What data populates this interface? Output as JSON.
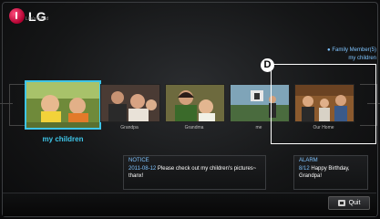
{
  "logo": {
    "brand": "LG",
    "tagline": "Life's Good"
  },
  "header": {
    "member_label": "Family Member(5)",
    "group_label": "my children"
  },
  "callout": {
    "marker": "D"
  },
  "carousel": {
    "selected": {
      "label": "my children"
    },
    "items": [
      {
        "label": "Grandpa"
      },
      {
        "label": "Grandma"
      },
      {
        "label": "me"
      },
      {
        "label": "Our Home"
      }
    ]
  },
  "notice": {
    "title": "NOTICE",
    "date": "2011-08-12",
    "message": "Please check out my children's pictures~ thanx!"
  },
  "alarm": {
    "title": "ALARM",
    "date": "8/12",
    "message": "Happy Birthday, Grandpa!"
  },
  "footer": {
    "quit_label": "Quit"
  },
  "colors": {
    "accent": "#3ec5e8",
    "info_text": "#7fc4ff",
    "brand": "#c0003a"
  }
}
